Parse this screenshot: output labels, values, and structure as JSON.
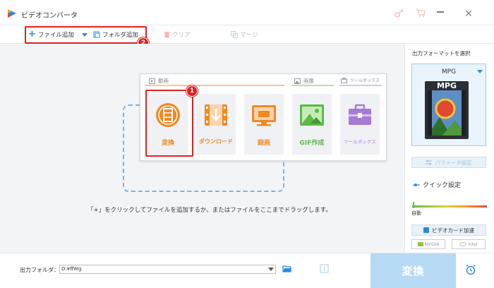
{
  "app": {
    "title": "ビデオコンバータ"
  },
  "toolbar": {
    "add_file": "ファイル追加",
    "add_folder": "フォルダ追加",
    "clear": "クリア",
    "merge": "マージ"
  },
  "badges": {
    "one": "1",
    "two": "2"
  },
  "popup": {
    "section_video": "動画",
    "section_image": "画像",
    "section_toolbox": "ツールボックス",
    "cards": [
      {
        "label": "変換",
        "color": "#f08a24"
      },
      {
        "label": "ダウンロード",
        "color": "#f08a24"
      },
      {
        "label": "録画",
        "color": "#f08a24"
      },
      {
        "label": "GIF作成",
        "color": "#5cb848"
      },
      {
        "label": "ツールボックス",
        "color": "#a57bd6"
      }
    ]
  },
  "main": {
    "hint": "「+」をクリックしてファイルを追加するか、またはファイルをここまでドラッグします。"
  },
  "side": {
    "title": "出力フォーマットを選択",
    "format": "MPG",
    "format_icon_text": "MPG",
    "param_button": "パラメータ設定",
    "quick": "クイック設定",
    "slider_label": "自動",
    "gpu_button": "ビデオカード加速",
    "nvidia": "NVIDIA",
    "intel": "Intel"
  },
  "bottom": {
    "output_label": "出力フォルダ：",
    "output_path": "D:¥ffWg",
    "convert": "変換"
  },
  "colors": {
    "accent": "#2a8ad9",
    "red": "#e02020",
    "orange": "#f08a24"
  }
}
